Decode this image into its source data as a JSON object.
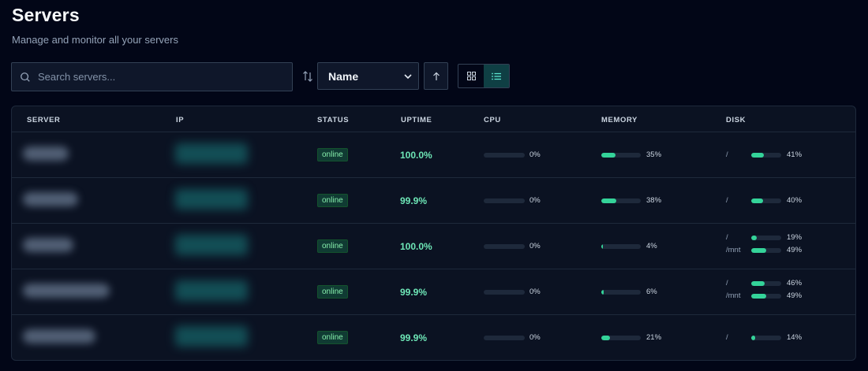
{
  "page": {
    "title": "Servers",
    "subtitle": "Manage and monitor all your servers"
  },
  "toolbar": {
    "search_placeholder": "Search servers...",
    "sort_selected": "Name",
    "sort_direction": "ascending",
    "view_mode": "list"
  },
  "table": {
    "headers": [
      "SERVER",
      "IP",
      "STATUS",
      "UPTIME",
      "CPU",
      "MEMORY",
      "DISK"
    ],
    "rows": [
      {
        "status": "online",
        "uptime": "100.0%",
        "cpu": {
          "label": "0%",
          "value": 0
        },
        "memory": {
          "label": "35%",
          "value": 35
        },
        "disks": [
          {
            "mount": "/",
            "label": "41%",
            "value": 41
          }
        ]
      },
      {
        "status": "online",
        "uptime": "99.9%",
        "cpu": {
          "label": "0%",
          "value": 0
        },
        "memory": {
          "label": "38%",
          "value": 38
        },
        "disks": [
          {
            "mount": "/",
            "label": "40%",
            "value": 40
          }
        ]
      },
      {
        "status": "online",
        "uptime": "100.0%",
        "cpu": {
          "label": "0%",
          "value": 0
        },
        "memory": {
          "label": "4%",
          "value": 4
        },
        "disks": [
          {
            "mount": "/",
            "label": "19%",
            "value": 19
          },
          {
            "mount": "/mnt",
            "label": "49%",
            "value": 49
          }
        ]
      },
      {
        "status": "online",
        "uptime": "99.9%",
        "cpu": {
          "label": "0%",
          "value": 0
        },
        "memory": {
          "label": "6%",
          "value": 6
        },
        "disks": [
          {
            "mount": "/",
            "label": "46%",
            "value": 46
          },
          {
            "mount": "/mnt",
            "label": "49%",
            "value": 49
          }
        ]
      },
      {
        "status": "online",
        "uptime": "99.9%",
        "cpu": {
          "label": "0%",
          "value": 0
        },
        "memory": {
          "label": "21%",
          "value": 21
        },
        "disks": [
          {
            "mount": "/",
            "label": "14%",
            "value": 14
          }
        ]
      }
    ]
  },
  "colors": {
    "background": "#020617",
    "accent": "#34d399",
    "badge_bg": "#103b33"
  },
  "icons": [
    "search-icon",
    "sort-icon",
    "chevron-down-icon",
    "arrow-up-icon",
    "grid-view-icon",
    "list-view-icon"
  ]
}
